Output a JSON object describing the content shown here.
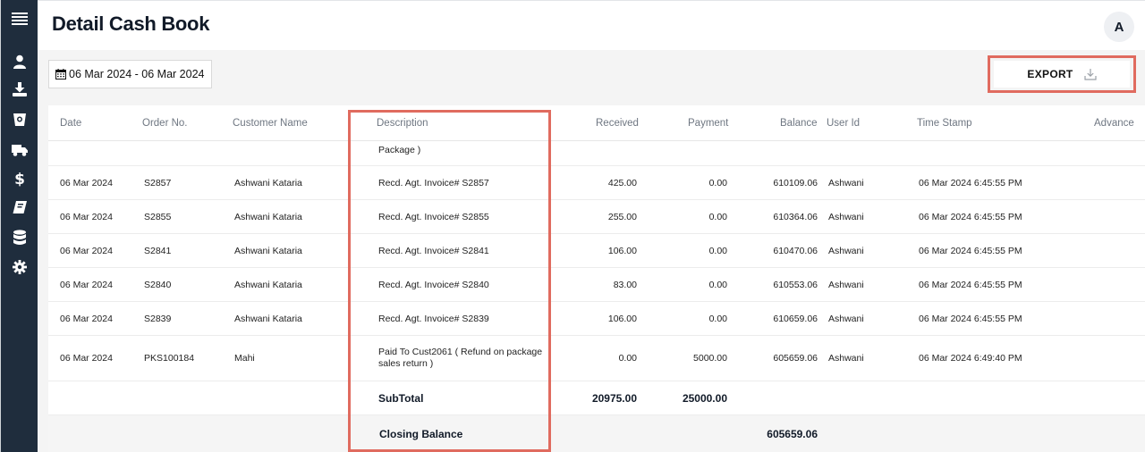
{
  "sidebar": {
    "items": [
      {
        "name": "menu-icon"
      },
      {
        "name": "user-icon"
      },
      {
        "name": "download-icon"
      },
      {
        "name": "bucket-icon"
      },
      {
        "name": "truck-icon"
      },
      {
        "name": "dollar-icon"
      },
      {
        "name": "book-icon"
      },
      {
        "name": "database-icon"
      },
      {
        "name": "gear-icon"
      }
    ]
  },
  "header": {
    "title": "Detail Cash Book",
    "avatar_initial": "A"
  },
  "toolbar": {
    "date_range": "06 Mar 2024 - 06 Mar 2024",
    "export_label": "EXPORT"
  },
  "table": {
    "columns": [
      "Date",
      "Order No.",
      "Customer Name",
      "Description",
      "Received",
      "Payment",
      "Balance",
      "User Id",
      "Time Stamp",
      "Advance"
    ],
    "partial_row": {
      "description": "Package )"
    },
    "rows": [
      {
        "date": "06 Mar 2024",
        "order": "S2857",
        "customer": "Ashwani Kataria",
        "description": "Recd. Agt. Invoice# S2857",
        "received": "425.00",
        "payment": "0.00",
        "balance": "610109.06",
        "user": "Ashwani",
        "timestamp": "06 Mar 2024 6:45:55 PM"
      },
      {
        "date": "06 Mar 2024",
        "order": "S2855",
        "customer": "Ashwani Kataria",
        "description": "Recd. Agt. Invoice# S2855",
        "received": "255.00",
        "payment": "0.00",
        "balance": "610364.06",
        "user": "Ashwani",
        "timestamp": "06 Mar 2024 6:45:55 PM"
      },
      {
        "date": "06 Mar 2024",
        "order": "S2841",
        "customer": "Ashwani Kataria",
        "description": "Recd. Agt. Invoice# S2841",
        "received": "106.00",
        "payment": "0.00",
        "balance": "610470.06",
        "user": "Ashwani",
        "timestamp": "06 Mar 2024 6:45:55 PM"
      },
      {
        "date": "06 Mar 2024",
        "order": "S2840",
        "customer": "Ashwani Kataria",
        "description": "Recd. Agt. Invoice# S2840",
        "received": "83.00",
        "payment": "0.00",
        "balance": "610553.06",
        "user": "Ashwani",
        "timestamp": "06 Mar 2024 6:45:55 PM"
      },
      {
        "date": "06 Mar 2024",
        "order": "S2839",
        "customer": "Ashwani Kataria",
        "description": "Recd. Agt. Invoice# S2839",
        "received": "106.00",
        "payment": "0.00",
        "balance": "610659.06",
        "user": "Ashwani",
        "timestamp": "06 Mar 2024 6:45:55 PM"
      },
      {
        "date": "06 Mar 2024",
        "order": "PKS100184",
        "customer": "Mahi",
        "description": "Paid To Cust2061 ( Refund on package sales return )",
        "received": "0.00",
        "payment": "5000.00",
        "balance": "605659.06",
        "user": "Ashwani",
        "timestamp": "06 Mar 2024 6:49:40 PM"
      }
    ],
    "subtotal": {
      "label": "SubTotal",
      "received": "20975.00",
      "payment": "25000.00"
    },
    "closing": {
      "label": "Closing Balance",
      "balance": "605659.06"
    }
  },
  "colors": {
    "sidebar_bg": "#1f2d3d",
    "highlight": "#e06b5f"
  }
}
